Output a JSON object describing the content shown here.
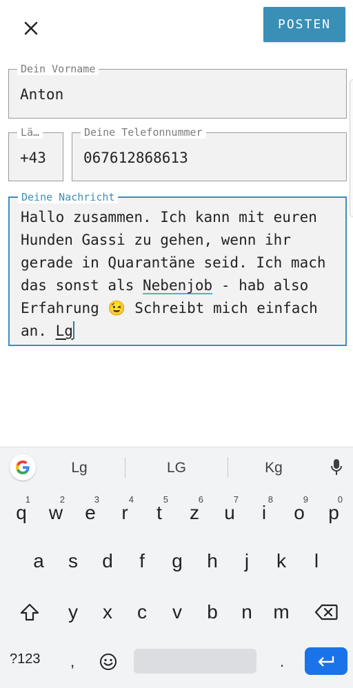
{
  "header": {
    "close_icon": "close-icon",
    "post_label": "POSTEN",
    "accent_color": "#3a8fb7"
  },
  "form": {
    "first_name": {
      "label": "Dein Vorname",
      "value": "Anton"
    },
    "country_code": {
      "label": "Lä…",
      "value": "+43"
    },
    "phone": {
      "label": "Deine Telefonnummer",
      "value": "067612868613"
    },
    "message": {
      "label": "Deine Nachricht",
      "text_before_underline": "Hallo zusammen. Ich kann mit euren Hunden Gassi zu gehen, wenn ihr gerade in Quarantäne seid. Ich mach das sonst als ",
      "underlined_word": "Nebenjob",
      "text_middle": " - hab also Erfahrung 😉 Schreibt mich einfach an. ",
      "composing_word": "Lg"
    }
  },
  "keyboard": {
    "suggestions": [
      "Lg",
      "LG",
      "Kg"
    ],
    "row1": [
      {
        "key": "q",
        "num": "1"
      },
      {
        "key": "w",
        "num": "2"
      },
      {
        "key": "e",
        "num": "3"
      },
      {
        "key": "r",
        "num": "4"
      },
      {
        "key": "t",
        "num": "5"
      },
      {
        "key": "z",
        "num": "6"
      },
      {
        "key": "u",
        "num": "7"
      },
      {
        "key": "i",
        "num": "8"
      },
      {
        "key": "o",
        "num": "9"
      },
      {
        "key": "p",
        "num": "0"
      }
    ],
    "row2": [
      "a",
      "s",
      "d",
      "f",
      "g",
      "h",
      "j",
      "k",
      "l"
    ],
    "row3": [
      "y",
      "x",
      "c",
      "v",
      "b",
      "n",
      "m"
    ],
    "bottom": {
      "symbols": "?123",
      "comma": ",",
      "period": "."
    },
    "enter_color": "#1a73e8"
  }
}
